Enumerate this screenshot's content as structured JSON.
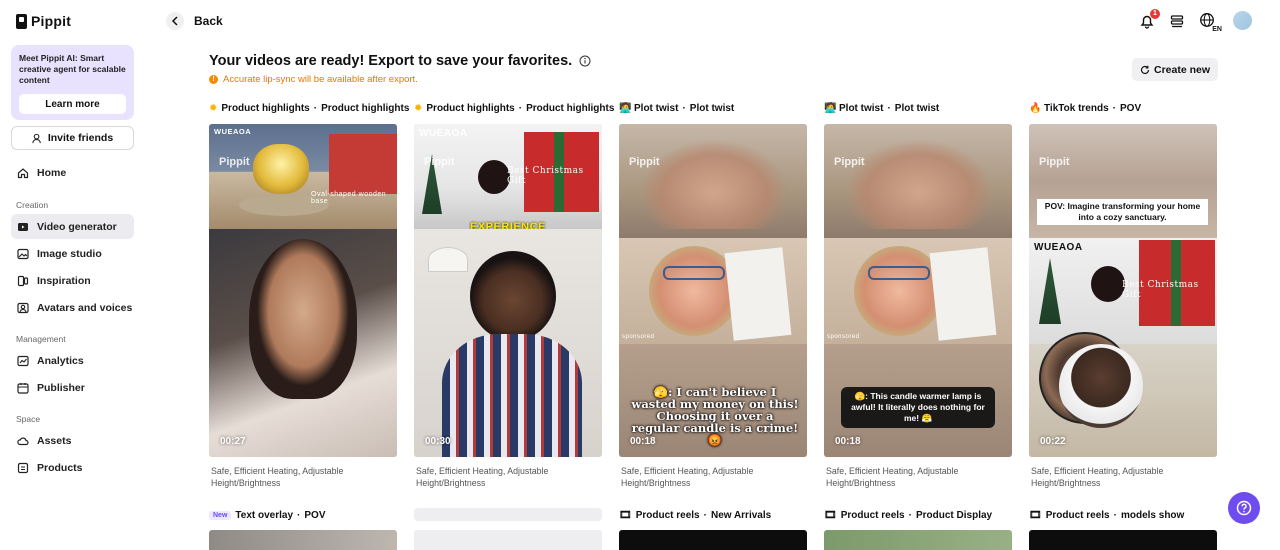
{
  "brand": {
    "name": "Pippit"
  },
  "promo": {
    "text": "Meet Pippit AI: Smart creative agent for scalable content",
    "button": "Learn more"
  },
  "invite": {
    "label": "Invite friends"
  },
  "nav": {
    "home": "Home",
    "creation_label": "Creation",
    "video_generator": "Video generator",
    "image_studio": "Image studio",
    "inspiration": "Inspiration",
    "avatars": "Avatars and voices",
    "management_label": "Management",
    "analytics": "Analytics",
    "publisher": "Publisher",
    "space_label": "Space",
    "assets": "Assets",
    "products": "Products"
  },
  "topbar": {
    "back": "Back",
    "notification_count": "1",
    "lang": "EN"
  },
  "header": {
    "title": "Your videos are ready! Export to save your favorites.",
    "notice": "Accurate lip-sync will be available after export.",
    "create_new": "Create new"
  },
  "videos": [
    {
      "tag": "Product highlights",
      "style": "Product highlights",
      "duration": "00:27",
      "desc": "Safe, Efficient Heating, Adjustable Height/Brightness",
      "brand": "WUEAOA",
      "watermark": "Pippit",
      "overlay": "Oval-shaped wooden base"
    },
    {
      "tag": "Product highlights",
      "style": "Product highlights",
      "duration": "00:30",
      "desc": "Safe, Efficient Heating, Adjustable Height/Brightness",
      "brand": "WUEAOA",
      "watermark": "Pippit",
      "overlay": "Best Christmas Gift",
      "overlay2": "EXPERIENCE"
    },
    {
      "tag": "Plot twist",
      "style": "Plot twist",
      "duration": "00:18",
      "desc": "Safe, Efficient Heating, Adjustable Height/Brightness",
      "watermark": "Pippit",
      "sponsored": "sponsored",
      "overlay": "🫣: I can't believe I wasted my money on this! Choosing it over a regular candle is a crime! 😡"
    },
    {
      "tag": "Plot twist",
      "style": "Plot twist",
      "duration": "00:18",
      "desc": "Safe, Efficient Heating, Adjustable Height/Brightness",
      "watermark": "Pippit",
      "sponsored": "sponsored",
      "overlay": "🫣: This candle warmer lamp is awful! It literally does nothing for me! 😤"
    },
    {
      "tag": "TikTok trends",
      "style": "POV",
      "duration": "00:22",
      "desc": "Safe, Efficient Heating, Adjustable Height/Brightness",
      "brand": "WUEAOA",
      "watermark": "Pippit",
      "overlay": "POV: Imagine transforming your home into a cozy sanctuary.",
      "overlay2": "Best Christmas Gift"
    }
  ],
  "row2": [
    {
      "badge": "New",
      "tag": "Text overlay",
      "style": "POV"
    },
    {
      "tag": "",
      "style": ""
    },
    {
      "tag": "Product reels",
      "style": "New Arrivals"
    },
    {
      "tag": "Product reels",
      "style": "Product Display"
    },
    {
      "tag": "Product reels",
      "style": "models show"
    }
  ],
  "separator": "·",
  "colors": {
    "accent": "#6e4cf0",
    "notice": "#e07b00",
    "active_nav": "#ececf0",
    "promo_bg": "#e8e2ff"
  }
}
